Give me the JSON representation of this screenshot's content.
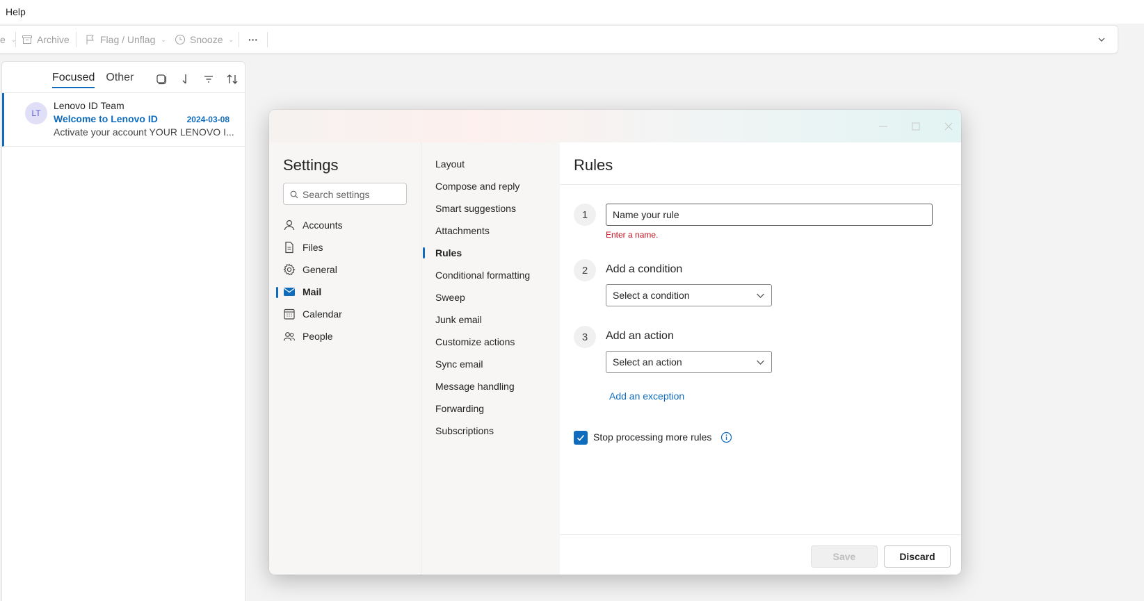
{
  "menubar": {
    "help": "Help"
  },
  "ribbon": {
    "partial_left": "e",
    "archive": "Archive",
    "flag": "Flag / Unflag",
    "snooze": "Snooze",
    "more": "···"
  },
  "maillist": {
    "tabs": {
      "focused": "Focused",
      "other": "Other"
    },
    "tools": [
      "select-icon",
      "sort-arrow-icon",
      "filter-icon",
      "sort-icon"
    ],
    "items": [
      {
        "initials": "LT",
        "sender": "Lenovo ID Team",
        "subject": "Welcome to Lenovo ID",
        "date": "2024-03-08",
        "preview": "Activate your account YOUR LENOVO I..."
      }
    ]
  },
  "settings": {
    "title": "Settings",
    "search_placeholder": "Search settings",
    "nav": [
      {
        "label": "Accounts",
        "icon": "person-icon"
      },
      {
        "label": "Files",
        "icon": "document-icon"
      },
      {
        "label": "General",
        "icon": "gear-icon"
      },
      {
        "label": "Mail",
        "icon": "mail-icon",
        "active": true
      },
      {
        "label": "Calendar",
        "icon": "calendar-icon"
      },
      {
        "label": "People",
        "icon": "people-icon"
      }
    ],
    "sub_nav": [
      {
        "label": "Layout"
      },
      {
        "label": "Compose and reply"
      },
      {
        "label": "Smart suggestions"
      },
      {
        "label": "Attachments"
      },
      {
        "label": "Rules",
        "active": true
      },
      {
        "label": "Conditional formatting"
      },
      {
        "label": "Sweep"
      },
      {
        "label": "Junk email"
      },
      {
        "label": "Customize actions"
      },
      {
        "label": "Sync email"
      },
      {
        "label": "Message handling"
      },
      {
        "label": "Forwarding"
      },
      {
        "label": "Subscriptions"
      }
    ]
  },
  "rules": {
    "title": "Rules",
    "step1": {
      "num": "1",
      "placeholder": "Name your rule",
      "value": "",
      "error": "Enter a name."
    },
    "step2": {
      "num": "2",
      "label": "Add a condition",
      "dropdown": "Select a condition"
    },
    "step3": {
      "num": "3",
      "label": "Add an action",
      "dropdown": "Select an action"
    },
    "exception_link": "Add an exception",
    "stop_processing": {
      "label": "Stop processing more rules",
      "checked": true
    },
    "buttons": {
      "save": "Save",
      "discard": "Discard"
    }
  },
  "colors": {
    "accent": "#0f6cbd",
    "error": "#c50f1f",
    "avatar_bg": "#e0dff7"
  }
}
